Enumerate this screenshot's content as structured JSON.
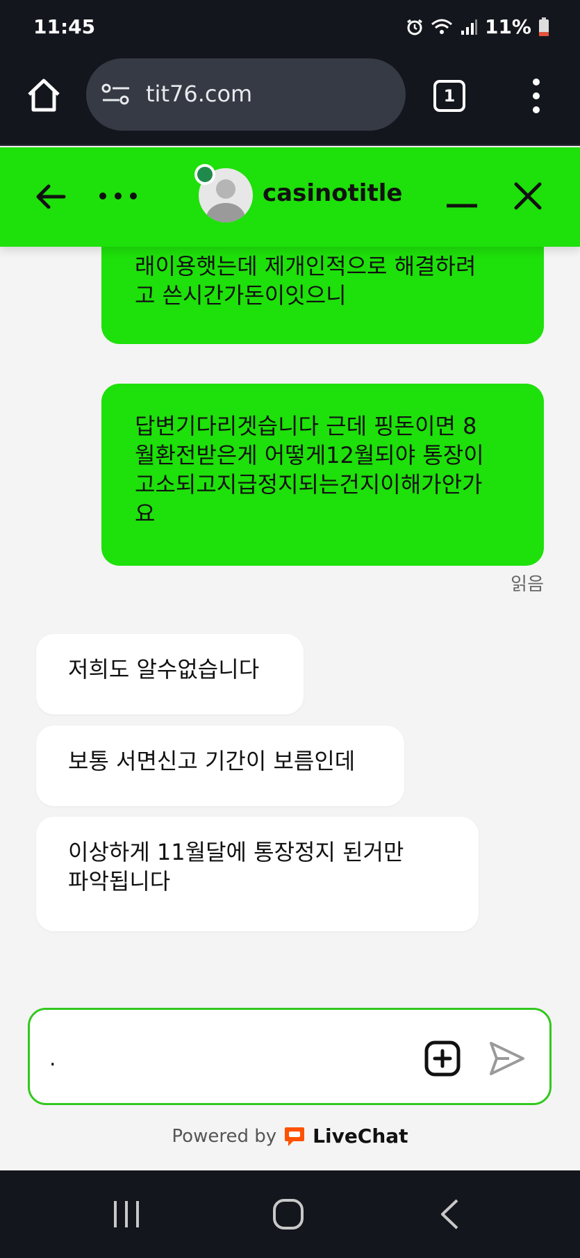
{
  "status_bar": {
    "time": "11:45",
    "battery": "11%"
  },
  "browser": {
    "url": "tit76.com",
    "tab_count": "1"
  },
  "chat_header": {
    "agent_name": "casinotitle",
    "accent_color": "#1ee00a",
    "online_color": "#1f8a4c"
  },
  "messages": {
    "visitor": [
      {
        "text": "래이용햇는데 제개인적으로 해결하려\n고 쓴시간가돈이잇으니"
      },
      {
        "text": "답변기다리겟습니다 근데 핑돈이면 8\n월환전받은게 어떻게12월되야 통장이\n고소되고지급정지되는건지이해가안가\n요"
      }
    ],
    "read_status": "읽음",
    "agent": [
      {
        "text": "저희도 알수없습니다"
      },
      {
        "text": "보통 서면신고 기간이 보름인데"
      },
      {
        "text": "이상하게 11월달에 통장정지 된거만\n파악됩니다"
      }
    ]
  },
  "composer": {
    "value": "."
  },
  "footer": {
    "powered_by": "Powered by",
    "brand": "LiveChat"
  },
  "icons": {
    "home": "home-icon",
    "site_settings": "tune-icon",
    "menu": "more-vertical-icon",
    "back": "arrow-left-icon",
    "more": "more-horizontal-icon",
    "minimize": "minimize-icon",
    "close": "close-icon",
    "attach": "plus-square-icon",
    "send": "send-icon"
  }
}
